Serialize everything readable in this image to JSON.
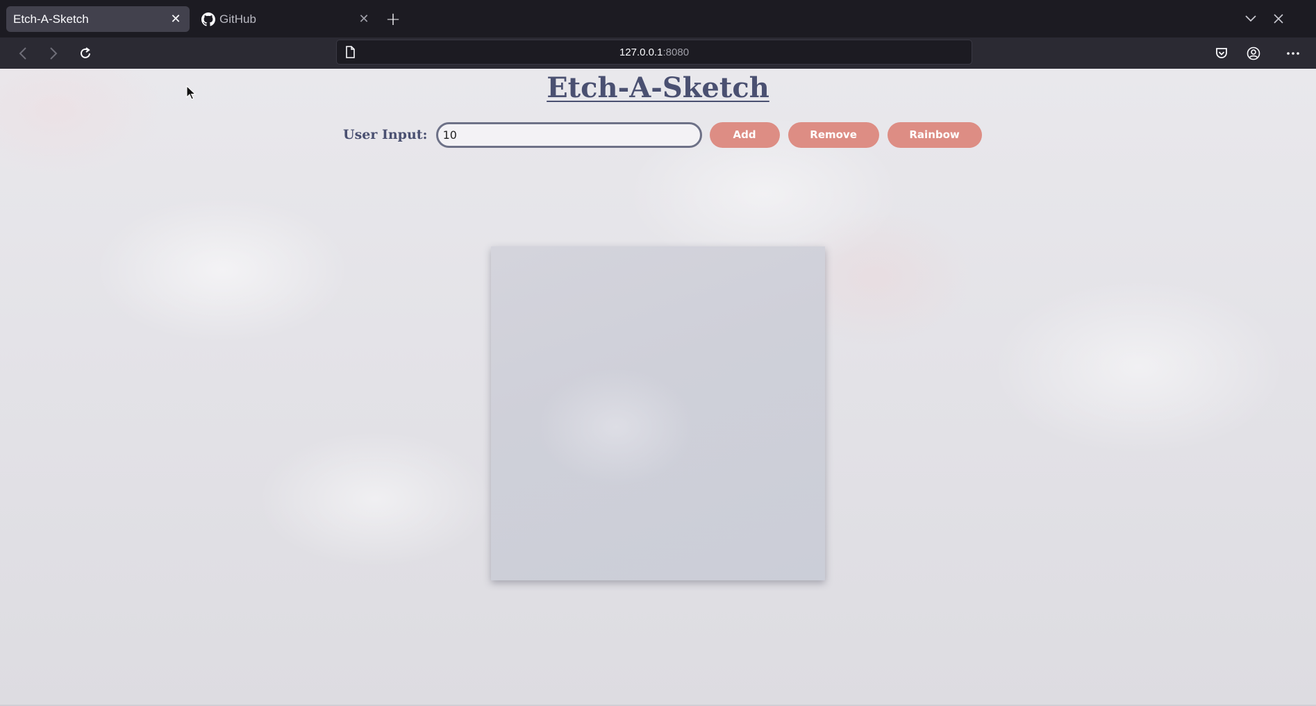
{
  "browser": {
    "tabs": [
      {
        "label": "Etch-A-Sketch",
        "active": true
      },
      {
        "label": "GitHub",
        "active": false
      }
    ],
    "url_host": "127.0.0.1",
    "url_port": ":8080"
  },
  "page": {
    "title": "Etch-A-Sketch",
    "input_label": "User Input:",
    "input_value": "10",
    "buttons": {
      "add": "Add",
      "remove": "Remove",
      "rainbow": "Rainbow"
    }
  },
  "colors": {
    "title": "#4a5071",
    "button": "#dd8d84"
  }
}
